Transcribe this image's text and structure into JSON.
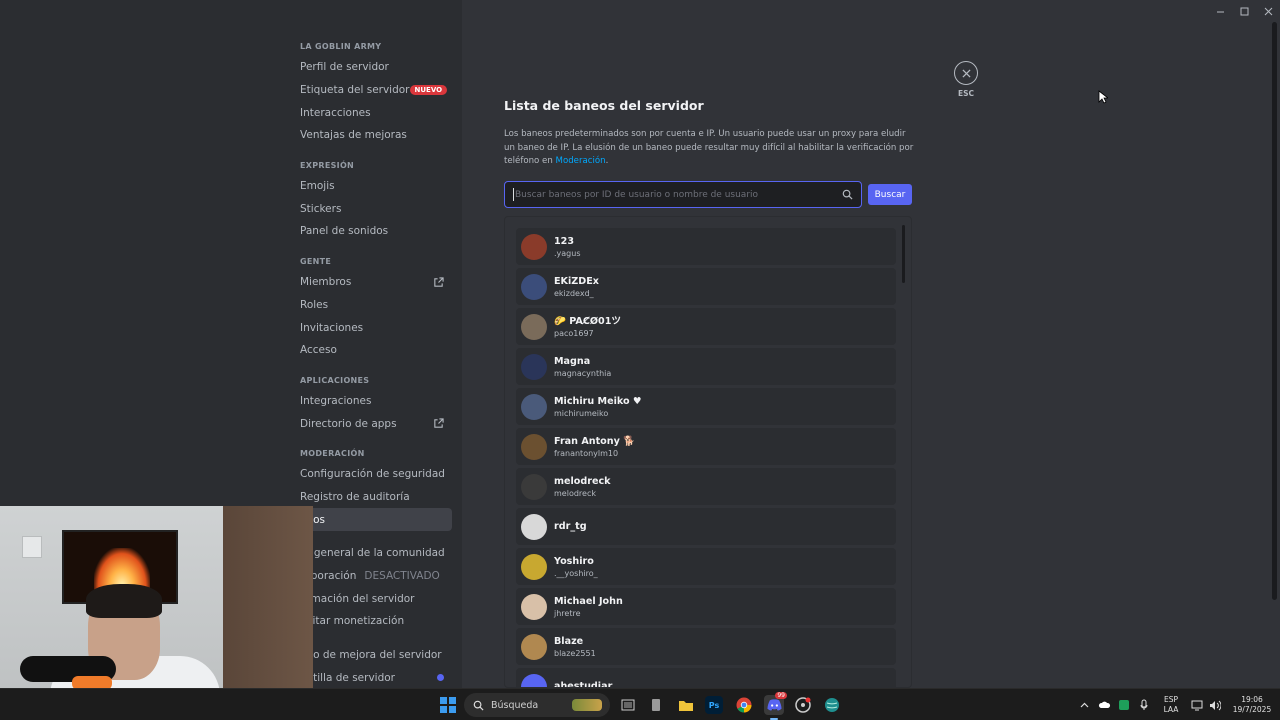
{
  "sidebar": {
    "server_name": "LA GOBLIN ARMY",
    "items_general": [
      {
        "label": "Perfil de servidor"
      },
      {
        "label": "Etiqueta del servidor",
        "badge": "NUEVO"
      },
      {
        "label": "Interacciones"
      },
      {
        "label": "Ventajas de mejoras"
      }
    ],
    "sec_expresion": "EXPRESIÓN",
    "items_expresion": [
      {
        "label": "Emojis"
      },
      {
        "label": "Stickers"
      },
      {
        "label": "Panel de sonidos"
      }
    ],
    "sec_gente": "GENTE",
    "items_gente": [
      {
        "label": "Miembros"
      },
      {
        "label": "Roles"
      },
      {
        "label": "Invitaciones"
      },
      {
        "label": "Acceso"
      }
    ],
    "sec_apps": "APLICACIONES",
    "items_apps": [
      {
        "label": "Integraciones"
      },
      {
        "label": "Directorio de apps"
      }
    ],
    "sec_moderacion": "MODERACIÓN",
    "items_moderacion": [
      {
        "label": "Configuración de seguridad"
      },
      {
        "label": "Registro de auditoría"
      },
      {
        "label": "neos"
      },
      {
        "label": "ta general de la comunidad"
      },
      {
        "label": "orporación",
        "status": "DESACTIVADO"
      },
      {
        "label": "ormación del servidor"
      },
      {
        "label": "bilitar monetización"
      },
      {
        "label": "ado de mejora del servidor"
      },
      {
        "label": "antilla de servidor"
      }
    ]
  },
  "main": {
    "title": "Lista de baneos del servidor",
    "description": "Los baneos predeterminados son por cuenta e IP. Un usuario puede usar un proxy para eludir un baneo de IP. La elusión de un baneo puede resultar muy difícil al habilitar la verificación por teléfono en",
    "description_link": "Moderación",
    "description_end": ".",
    "search_placeholder": "Buscar baneos por ID de usuario o nombre de usuario",
    "search_button": "Buscar",
    "esc_label": "ESC"
  },
  "bans": [
    {
      "display": "123",
      "username": ".yagus",
      "color": "#8a3b2a"
    },
    {
      "display": "EKiZDEx",
      "username": "ekizdexd_",
      "color": "#3b4d7a"
    },
    {
      "display": "🌮 PAC̸Ø01ツ",
      "username": "paco1697",
      "color": "#7a6b5a"
    },
    {
      "display": "Magna",
      "username": "magnacynthia",
      "color": "#2a3559"
    },
    {
      "display": "Michiru Meiko ♥",
      "username": "michirumeiko",
      "color": "#4a5a7a"
    },
    {
      "display": "Fran Antony 🐕",
      "username": "franantonylm10",
      "color": "#6b5030"
    },
    {
      "display": "melodreck",
      "username": "melodreck",
      "color": "#3a3a3a"
    },
    {
      "display": "rdr_tg",
      "username": "",
      "color": "#d8d8d8"
    },
    {
      "display": "Yoshiro",
      "username": ".__yoshiro_",
      "color": "#c8a830"
    },
    {
      "display": "Michael John",
      "username": "jhretre",
      "color": "#d8c0a8"
    },
    {
      "display": "Blaze",
      "username": "blaze2551",
      "color": "#b08850"
    },
    {
      "display": "ahestudiar",
      "username": "",
      "color": "#5865f2"
    }
  ],
  "taskbar": {
    "search_label": "Búsqueda",
    "lang_top": "ESP",
    "lang_bottom": "LAA",
    "time": "19:06",
    "date": "19/7/2025",
    "discord_badge": "99"
  },
  "colors": {
    "accent": "#5865f2",
    "badge_red": "#da373c",
    "link": "#00a8fc"
  }
}
